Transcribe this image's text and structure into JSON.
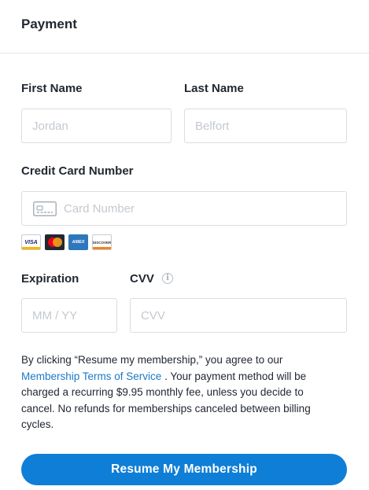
{
  "header": {
    "title": "Payment"
  },
  "first_name": {
    "label": "First Name",
    "placeholder": "Jordan"
  },
  "last_name": {
    "label": "Last Name",
    "placeholder": "Belfort"
  },
  "card_number": {
    "label": "Credit Card Number",
    "placeholder": "Card Number",
    "icon": "credit-card-icon"
  },
  "card_brands": [
    {
      "name": "visa-icon",
      "text": "VISA"
    },
    {
      "name": "mastercard-icon",
      "text": ""
    },
    {
      "name": "amex-icon",
      "text": "AMEX"
    },
    {
      "name": "discover-icon",
      "text": "DISCOVER"
    }
  ],
  "expiration": {
    "label": "Expiration",
    "placeholder": "MM / YY"
  },
  "cvv": {
    "label": "CVV",
    "placeholder": "CVV",
    "info_icon": "i"
  },
  "terms": {
    "prefix": "By clicking “Resume my membership,” you agree to our ",
    "link": "Membership Terms of Service",
    "suffix": " . Your payment method will be charged a recurring $9.95 monthly fee, unless you decide to cancel. No refunds for memberships canceled between billing cycles."
  },
  "submit": {
    "label": "Resume My Membership"
  },
  "colors": {
    "accent": "#0f7ed6",
    "link": "#1b79c7",
    "border": "#d9dde2",
    "placeholder": "#c4c9cf"
  }
}
